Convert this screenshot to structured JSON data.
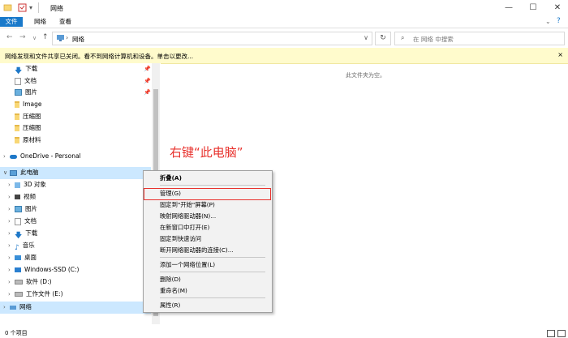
{
  "window": {
    "title": "网络"
  },
  "ribbon": {
    "tabs": [
      "文件",
      "网络",
      "查看"
    ]
  },
  "address": {
    "path": "网络"
  },
  "search": {
    "placeholder": "在 网络 中搜索"
  },
  "infobar": {
    "text": "网络发现和文件共享已关闭。看不到网络计算机和设备。单击以更改...",
    "close": "×"
  },
  "navpane": {
    "quick_items": [
      "下载",
      "文档",
      "图片",
      "Image",
      "压缩图",
      "压缩图",
      "原材料"
    ],
    "onedrive": "OneDrive - Personal",
    "thispc": "此电脑",
    "thispc_items": [
      "3D 对象",
      "视频",
      "图片",
      "文档",
      "下载",
      "音乐",
      "桌面",
      "Windows-SSD (C:)",
      "软件 (D:)",
      "工作文件 (E:)"
    ],
    "network": "网络"
  },
  "content": {
    "empty": "此文件夹为空。"
  },
  "annotation": "右键“此电脑”",
  "context_menu": {
    "items": [
      "折叠(A)",
      "管理(G)",
      "固定到\"开始\"屏幕(P)",
      "映射网络驱动器(N)...",
      "在新窗口中打开(E)",
      "固定到快速访问",
      "断开网络驱动器的连接(C)...",
      "添加一个网络位置(L)",
      "删除(D)",
      "重命名(M)",
      "属性(R)"
    ]
  },
  "status": {
    "text": "0 个项目"
  },
  "colors": {
    "accent": "#1979ca",
    "highlight": "#e8322d",
    "selection": "#cce8ff",
    "infobar": "#fffbcc"
  }
}
